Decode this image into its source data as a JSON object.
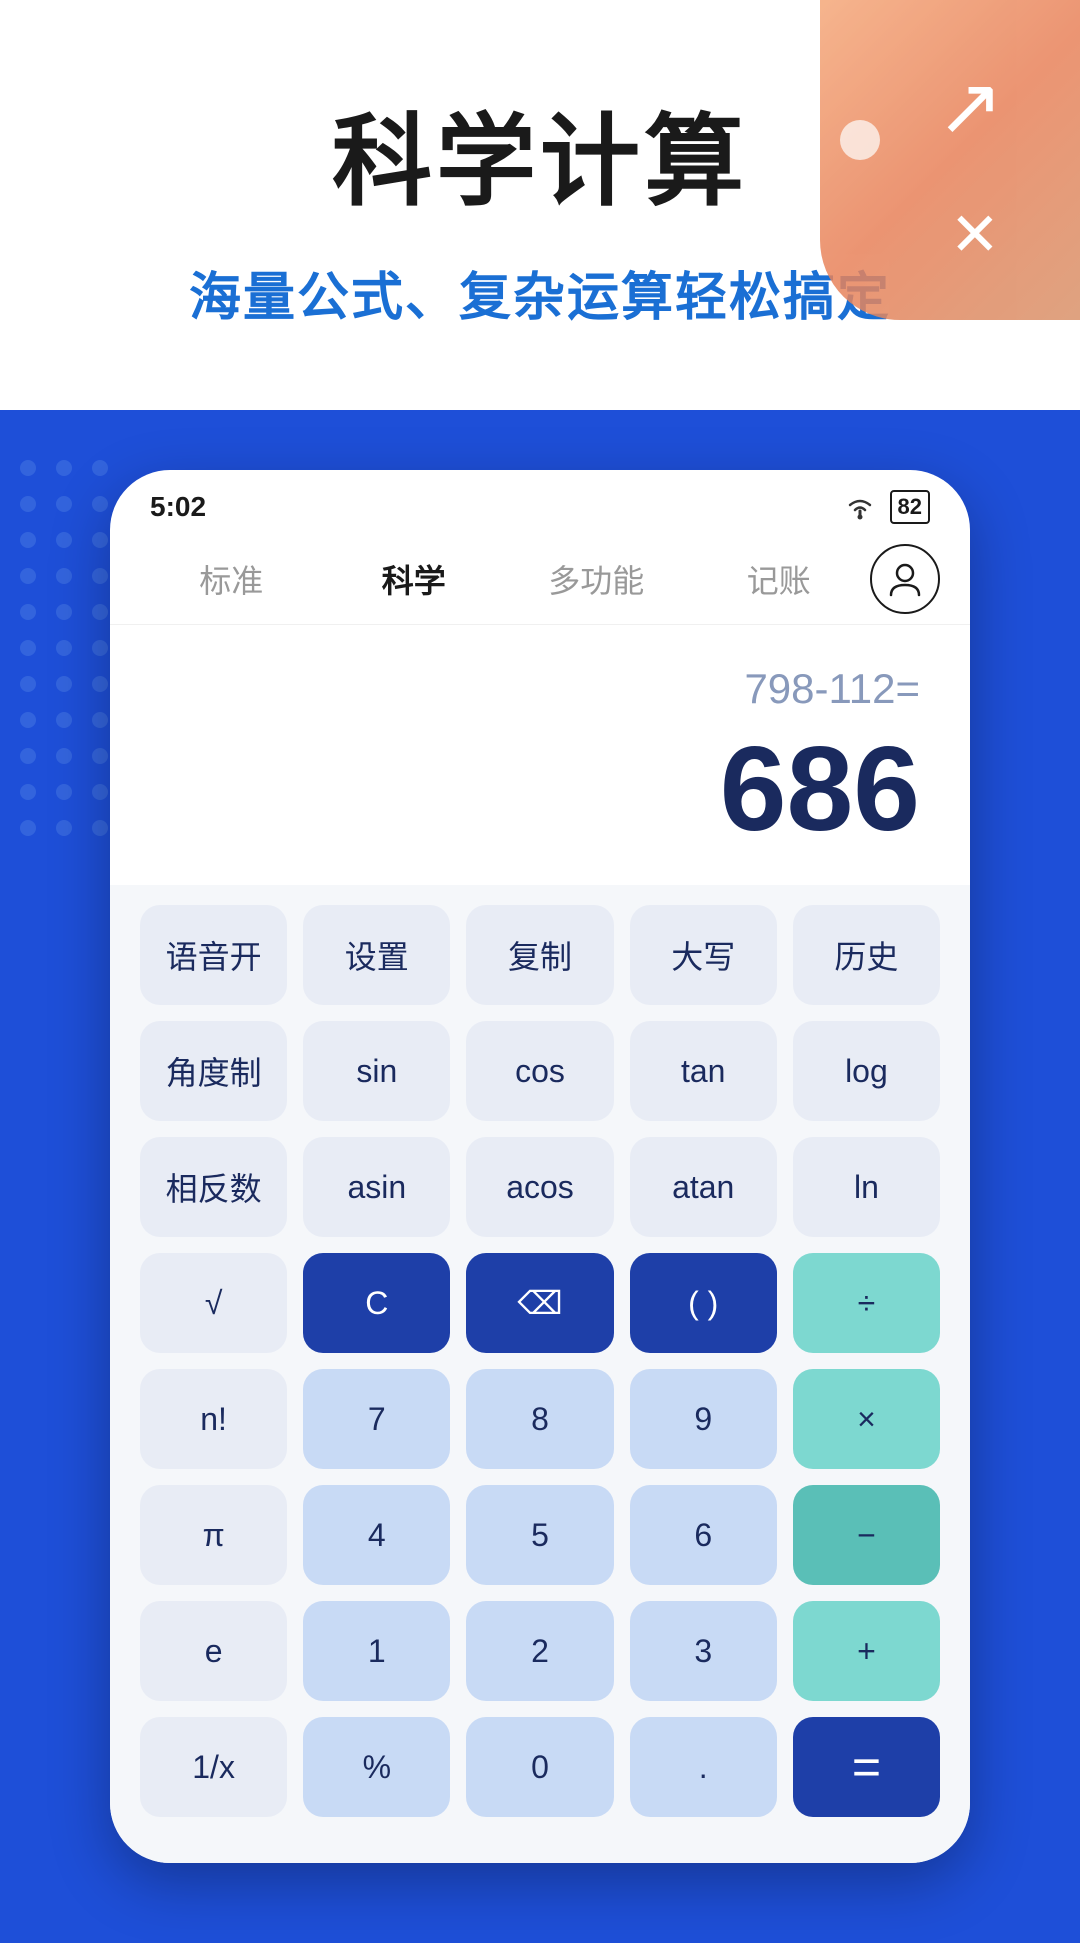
{
  "top": {
    "main_title": "科学计算",
    "subtitle": "海量公式、复杂运算轻松搞定"
  },
  "status_bar": {
    "time": "5:02",
    "battery": "82"
  },
  "tabs": [
    {
      "label": "标准",
      "active": false
    },
    {
      "label": "科学",
      "active": true
    },
    {
      "label": "多功能",
      "active": false
    },
    {
      "label": "记账",
      "active": false
    }
  ],
  "display": {
    "expression": "798-112=",
    "result": "686"
  },
  "keyboard": {
    "rows": [
      [
        {
          "label": "语音开",
          "type": "light"
        },
        {
          "label": "设置",
          "type": "light"
        },
        {
          "label": "复制",
          "type": "light"
        },
        {
          "label": "大写",
          "type": "light"
        },
        {
          "label": "历史",
          "type": "light"
        }
      ],
      [
        {
          "label": "角度制",
          "type": "light"
        },
        {
          "label": "sin",
          "type": "light"
        },
        {
          "label": "cos",
          "type": "light"
        },
        {
          "label": "tan",
          "type": "light"
        },
        {
          "label": "log",
          "type": "light"
        }
      ],
      [
        {
          "label": "相反数",
          "type": "light"
        },
        {
          "label": "asin",
          "type": "light"
        },
        {
          "label": "acos",
          "type": "light"
        },
        {
          "label": "atan",
          "type": "light"
        },
        {
          "label": "ln",
          "type": "light"
        }
      ],
      [
        {
          "label": "√",
          "type": "light"
        },
        {
          "label": "C",
          "type": "dark-blue"
        },
        {
          "label": "⌫",
          "type": "dark-blue"
        },
        {
          "label": "( )",
          "type": "dark-blue"
        },
        {
          "label": "÷",
          "type": "teal"
        }
      ],
      [
        {
          "label": "n!",
          "type": "light"
        },
        {
          "label": "7",
          "type": "light-blue"
        },
        {
          "label": "8",
          "type": "light-blue"
        },
        {
          "label": "9",
          "type": "light-blue"
        },
        {
          "label": "×",
          "type": "teal"
        }
      ],
      [
        {
          "label": "π",
          "type": "light"
        },
        {
          "label": "4",
          "type": "light-blue"
        },
        {
          "label": "5",
          "type": "light-blue"
        },
        {
          "label": "6",
          "type": "light-blue"
        },
        {
          "label": "−",
          "type": "teal-dark"
        }
      ],
      [
        {
          "label": "e",
          "type": "light"
        },
        {
          "label": "1",
          "type": "light-blue"
        },
        {
          "label": "2",
          "type": "light-blue"
        },
        {
          "label": "3",
          "type": "light-blue"
        },
        {
          "label": "+",
          "type": "teal"
        }
      ],
      [
        {
          "label": "1/x",
          "type": "light"
        },
        {
          "label": "%",
          "type": "light-blue"
        },
        {
          "label": "0",
          "type": "light-blue"
        },
        {
          "label": ".",
          "type": "light-blue"
        },
        {
          "label": "=",
          "type": "equals"
        }
      ]
    ]
  }
}
